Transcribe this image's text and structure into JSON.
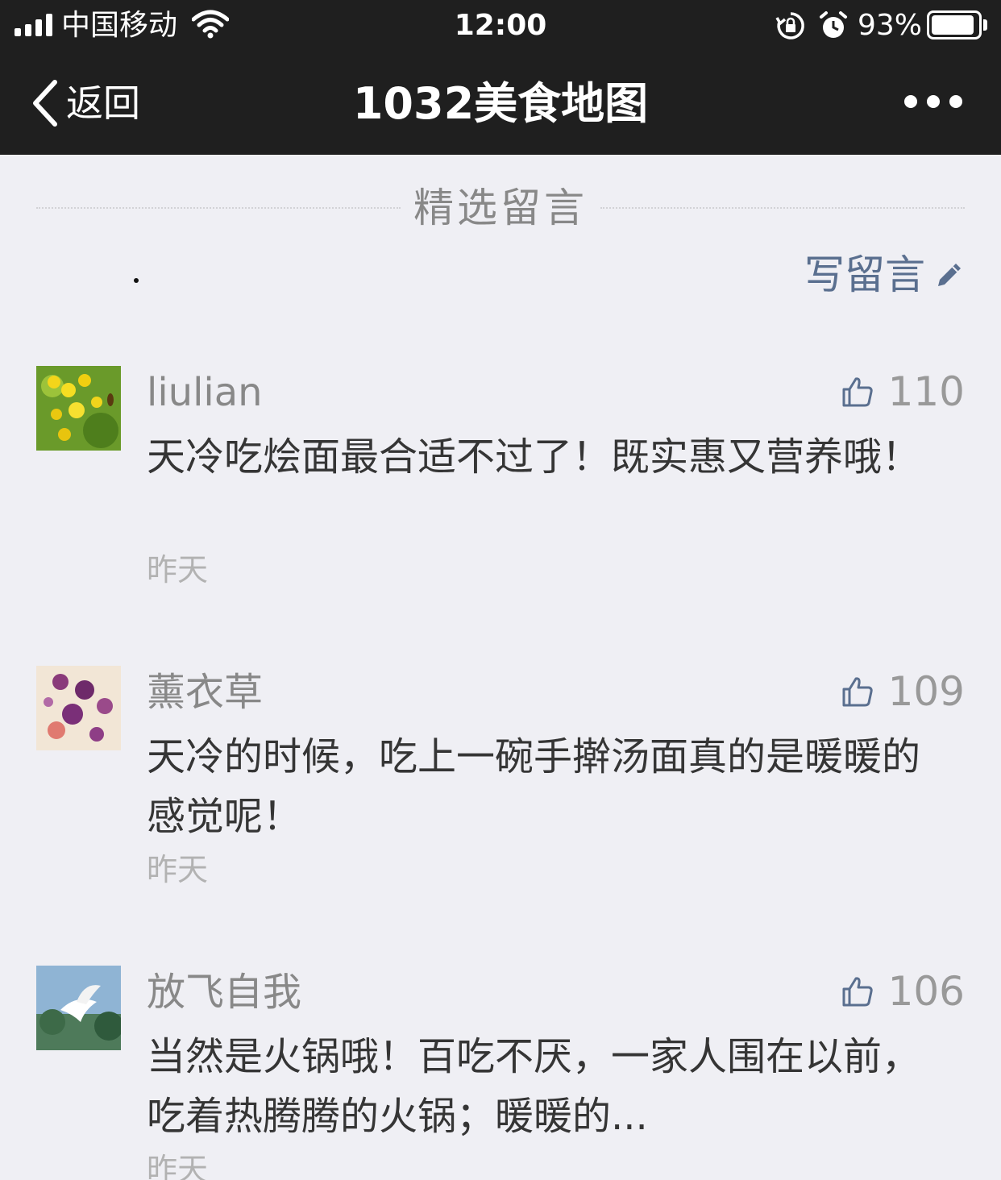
{
  "status_bar": {
    "carrier": "中国移动",
    "time": "12:00",
    "battery_percent": "93%",
    "battery_level": 0.93
  },
  "nav": {
    "back_label": "返回",
    "title": "1032美食地图"
  },
  "section": {
    "header": "精选留言",
    "write_label": "写留言"
  },
  "comments": [
    {
      "name": "liulian",
      "likes": "110",
      "text": "天冷吃烩面最合适不过了！既实惠又营养哦！",
      "time": "昨天",
      "avatar": "yellow-flower-avatar"
    },
    {
      "name": "薰衣草",
      "likes": "109",
      "text": "天冷的时候，吃上一碗手擀汤面真的是暖暖的感觉呢！",
      "time": "昨天",
      "avatar": "purple-flower-avatar"
    },
    {
      "name": "放飞自我",
      "likes": "106",
      "text": "当然是火锅哦！百吃不厌，一家人围在以前，吃着热腾腾的火锅；暖暖的...",
      "time": "昨天",
      "avatar": "dove-avatar"
    }
  ],
  "colors": {
    "bar_bg": "#1f1f1f",
    "page_bg": "#efeff4",
    "link": "#5a6f8f",
    "name": "#888888",
    "text": "#353535",
    "time": "#b2b2b2"
  }
}
